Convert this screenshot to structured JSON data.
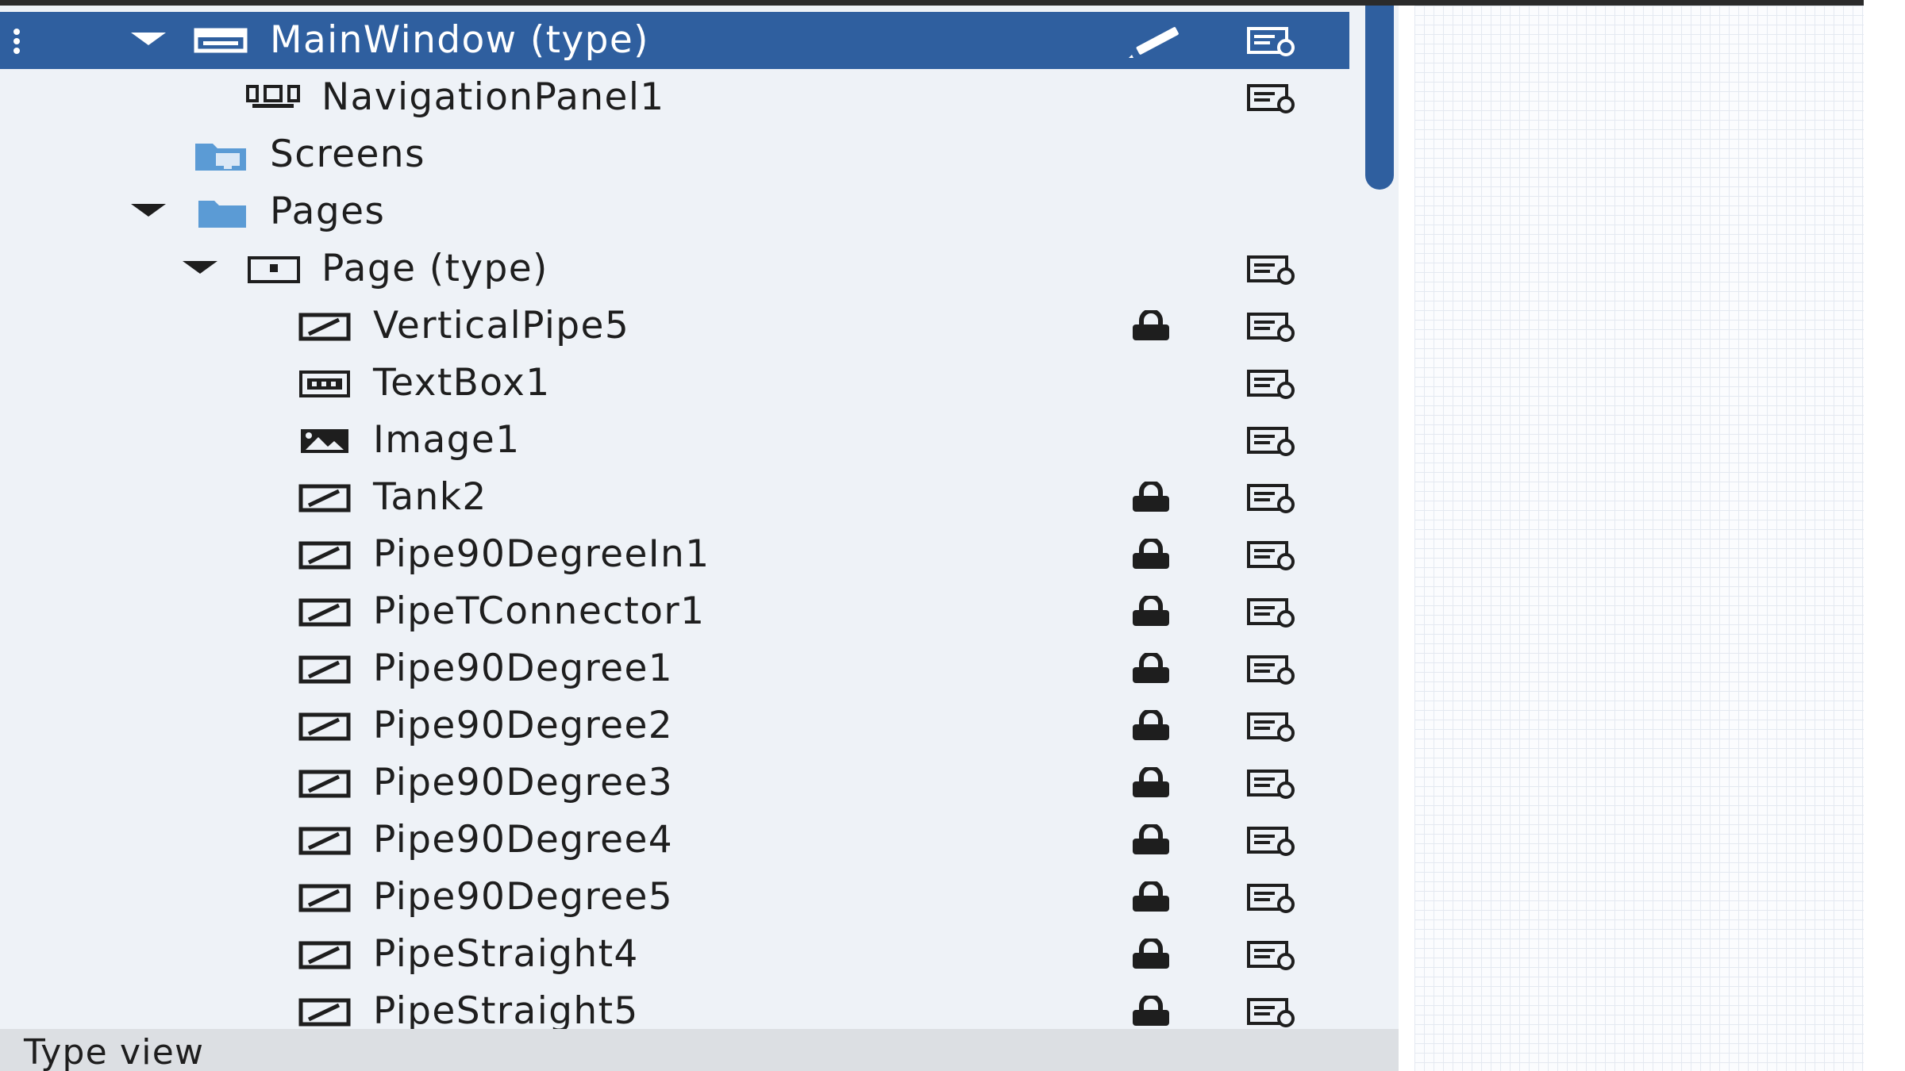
{
  "tree": {
    "rows": [
      {
        "label": "MainWindow (type)",
        "selected": true,
        "expanded": true,
        "icon": "window-icon",
        "locked": false,
        "props": true,
        "edit": true
      },
      {
        "label": "NavigationPanel1",
        "icon": "navigation-panel-icon",
        "locked": false,
        "props": true
      },
      {
        "label": "Screens",
        "icon": "screens-folder-icon",
        "locked": false,
        "props": false
      },
      {
        "label": "Pages",
        "expanded": true,
        "icon": "folder-icon",
        "locked": false,
        "props": false
      },
      {
        "label": "Page (type)",
        "expanded": true,
        "icon": "page-icon",
        "locked": false,
        "props": true
      },
      {
        "label": "VerticalPipe5",
        "icon": "symbol-icon",
        "locked": true,
        "props": true
      },
      {
        "label": "TextBox1",
        "icon": "textbox-icon",
        "locked": false,
        "props": true
      },
      {
        "label": "Image1",
        "icon": "image-icon",
        "locked": false,
        "props": true
      },
      {
        "label": "Tank2",
        "icon": "symbol-icon",
        "locked": true,
        "props": true
      },
      {
        "label": "Pipe90DegreeIn1",
        "icon": "symbol-icon",
        "locked": true,
        "props": true
      },
      {
        "label": "PipeTConnector1",
        "icon": "symbol-icon",
        "locked": true,
        "props": true
      },
      {
        "label": "Pipe90Degree1",
        "icon": "symbol-icon",
        "locked": true,
        "props": true
      },
      {
        "label": "Pipe90Degree2",
        "icon": "symbol-icon",
        "locked": true,
        "props": true
      },
      {
        "label": "Pipe90Degree3",
        "icon": "symbol-icon",
        "locked": true,
        "props": true
      },
      {
        "label": "Pipe90Degree4",
        "icon": "symbol-icon",
        "locked": true,
        "props": true
      },
      {
        "label": "Pipe90Degree5",
        "icon": "symbol-icon",
        "locked": true,
        "props": true
      },
      {
        "label": "PipeStraight4",
        "icon": "symbol-icon",
        "locked": true,
        "props": true
      },
      {
        "label": "PipeStraight5",
        "icon": "symbol-icon",
        "locked": true,
        "props": true
      }
    ]
  },
  "footer": {
    "label": "Type view"
  },
  "colors": {
    "selected": "#2f5f9f",
    "panel": "#eef2f7",
    "footer": "#dcdfe3"
  }
}
